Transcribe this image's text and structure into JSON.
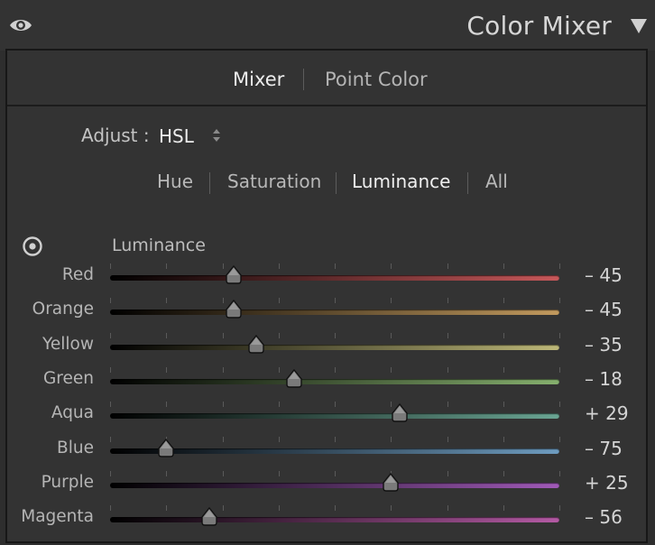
{
  "header": {
    "title": "Color Mixer",
    "visibility_icon": "eye-icon",
    "collapse_icon": "triangle-down-icon"
  },
  "mode_tabs": [
    {
      "label": "Mixer",
      "active": true
    },
    {
      "label": "Point Color",
      "active": false
    }
  ],
  "adjust": {
    "label": "Adjust :",
    "value": "HSL",
    "icon": "up-down-arrows-icon"
  },
  "sub_tabs": [
    {
      "label": "Hue",
      "active": false
    },
    {
      "label": "Saturation",
      "active": false
    },
    {
      "label": "Luminance",
      "active": true
    },
    {
      "label": "All",
      "active": false
    }
  ],
  "section": {
    "label": "Luminance",
    "target_icon": "target-adjust-icon"
  },
  "slider_range": [
    -100,
    100
  ],
  "sliders": [
    {
      "label": "Red",
      "value": -45,
      "display": "– 45",
      "color": "#c8585a"
    },
    {
      "label": "Orange",
      "value": -45,
      "display": "– 45",
      "color": "#c29a5e"
    },
    {
      "label": "Yellow",
      "value": -35,
      "display": "– 35",
      "color": "#bdb878"
    },
    {
      "label": "Green",
      "value": -18,
      "display": "– 18",
      "color": "#86b06e"
    },
    {
      "label": "Aqua",
      "value": 29,
      "display": "+ 29",
      "color": "#6aa593"
    },
    {
      "label": "Blue",
      "value": -75,
      "display": "– 75",
      "color": "#6e9cc0"
    },
    {
      "label": "Purple",
      "value": 25,
      "display": "+ 25",
      "color": "#a05ab8"
    },
    {
      "label": "Magenta",
      "value": -56,
      "display": "– 56",
      "color": "#b45aa4"
    }
  ]
}
